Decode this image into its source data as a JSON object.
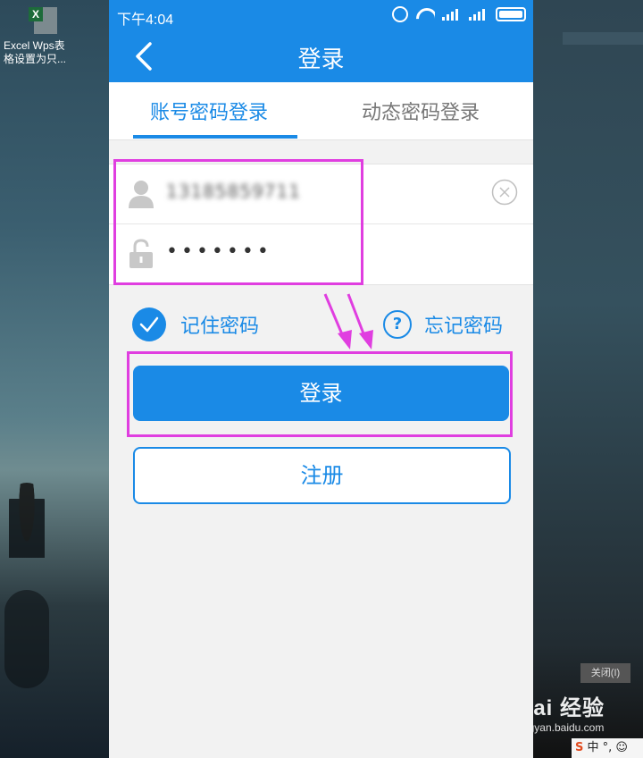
{
  "desktop": {
    "file_label_line1": "Excel Wps表",
    "file_label_line2": "格设置为只...",
    "file_icon_badge": "X",
    "right_button": "关闭(I)",
    "watermark_logo": "Bai 经验",
    "watermark_url": "jingyan.baidu.com",
    "ime_logo": "S",
    "ime_text": "中 °, ☺"
  },
  "statusbar": {
    "time": "下午4:04"
  },
  "header": {
    "title": "登录"
  },
  "tabs": [
    {
      "label": "账号密码登录",
      "active": true
    },
    {
      "label": "动态密码登录",
      "active": false
    }
  ],
  "form": {
    "username_value": "13185859711",
    "password_masked": "•••••••"
  },
  "options": {
    "remember_label": "记住密码",
    "remember_checked": true,
    "forgot_label": "忘记密码"
  },
  "actions": {
    "login_label": "登录",
    "register_label": "注册"
  },
  "colors": {
    "accent": "#1a8ae6",
    "highlight": "#e03ee0"
  }
}
